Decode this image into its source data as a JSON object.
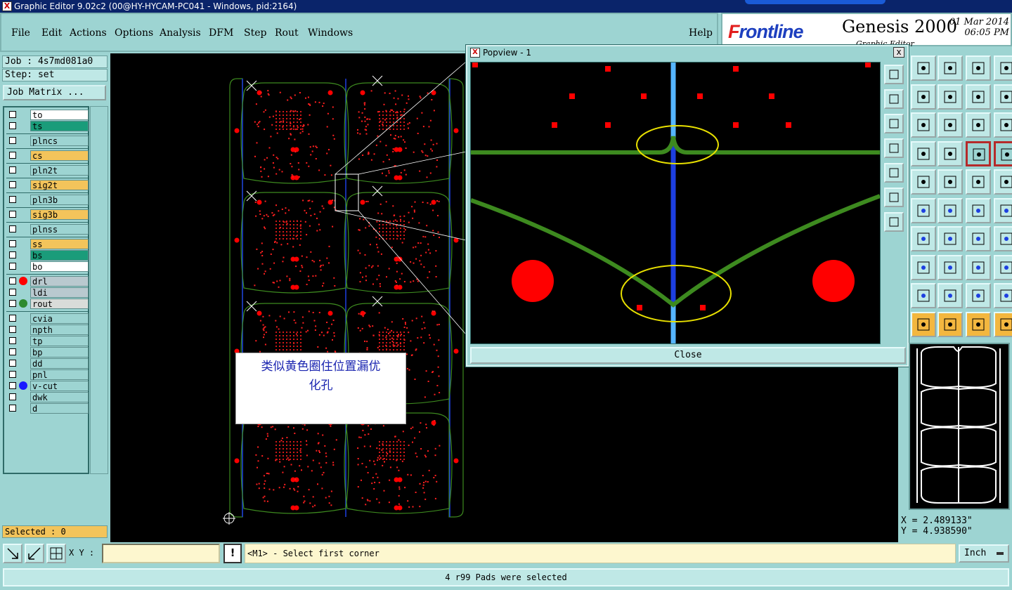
{
  "window": {
    "title": "Graphic Editor 9.02c2 (00@HY-HYCAM-PC041 - Windows, pid:2164)"
  },
  "menu": {
    "items": [
      {
        "label": "File"
      },
      {
        "label": "Edit"
      },
      {
        "label": "Actions"
      },
      {
        "label": "Options"
      },
      {
        "label": "Analysis"
      },
      {
        "label": "DFM"
      },
      {
        "label": "Step"
      },
      {
        "label": "Rout"
      },
      {
        "label": "Windows"
      }
    ],
    "help": "Help"
  },
  "brand": {
    "logo_first": "F",
    "logo_rest": "rontline",
    "product": "Genesis 2000",
    "date": "01 Mar 2014",
    "time": "06:05 PM",
    "subtitle": "Graphic Editor"
  },
  "job": {
    "job_label": "Job : 4s7md081a0",
    "step_label": "Step: set",
    "matrix_button": "Job Matrix ..."
  },
  "layers": [
    {
      "name": "to",
      "color": "#ffffff"
    },
    {
      "name": "ts",
      "color": "#1a9c7a"
    },
    {
      "name": "plncs",
      "color": "#9dd4d2"
    },
    {
      "name": "cs",
      "color": "#f3c45b"
    },
    {
      "name": "pln2t",
      "color": "#9dd4d2"
    },
    {
      "name": "sig2t",
      "color": "#f3c45b"
    },
    {
      "name": "pln3b",
      "color": "#9dd4d2"
    },
    {
      "name": "sig3b",
      "color": "#f3c45b"
    },
    {
      "name": "plnss",
      "color": "#9dd4d2"
    },
    {
      "name": "ss",
      "color": "#f3c45b"
    },
    {
      "name": "bs",
      "color": "#1a9c7a"
    },
    {
      "name": "bo",
      "color": "#ffffff"
    },
    {
      "name": "drl",
      "color": "#b9c9cf",
      "dot": "#ff0000"
    },
    {
      "name": "ldi",
      "color": "#b9c9cf"
    },
    {
      "name": "rout",
      "color": "#d9dcd9",
      "dot": "#2e8b2e"
    },
    {
      "name": "cvia",
      "color": "#9dd4d2"
    },
    {
      "name": "npth",
      "color": "#9dd4d2"
    },
    {
      "name": "tp",
      "color": "#9dd4d2"
    },
    {
      "name": "bp",
      "color": "#9dd4d2"
    },
    {
      "name": "dd",
      "color": "#9dd4d2"
    },
    {
      "name": "pnl",
      "color": "#9dd4d2"
    },
    {
      "name": "v-cut",
      "color": "#9dd4d2",
      "dot": "#1a1aff"
    },
    {
      "name": "dwk",
      "color": "#9dd4d2"
    },
    {
      "name": "d",
      "color": "#9dd4d2"
    }
  ],
  "selected_label": "Selected : 0",
  "annotation": {
    "line1": "类似黄色圈住位置漏优",
    "line2": "化孔"
  },
  "popview": {
    "title": "Popview - 1",
    "close_x": "x",
    "close_button": "Close"
  },
  "coords": {
    "x": "X = 2.489133\"",
    "y": "Y = 4.938590\""
  },
  "bottom": {
    "xy_label": "X Y :",
    "xy_value": "",
    "warn": "!",
    "prompt": "<M1> - Select first corner",
    "units": "Inch",
    "status": "4 r99 Pads were selected"
  },
  "colors": {
    "panel": "#9dd4d2",
    "pad": "#ff0000",
    "rout": "#3d8a1f",
    "vcut": "#1d3fe0",
    "highlight": "#e8e000"
  }
}
